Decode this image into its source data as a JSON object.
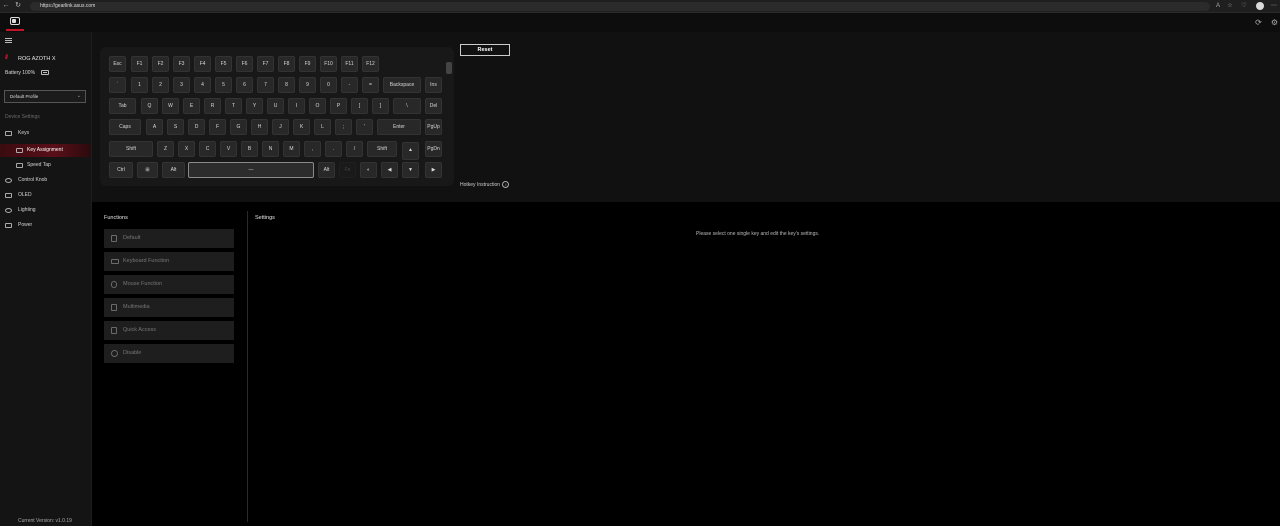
{
  "browser": {
    "url": "https://gearlink.asus.com",
    "back_icon": "back-arrow-icon",
    "refresh_icon": "refresh-icon"
  },
  "sidebar": {
    "device_name": "ROG AZOTH X",
    "battery": "Battery 100%",
    "profile": "Default Profile",
    "section": "Device Settings",
    "items": [
      {
        "label": "Keys"
      },
      {
        "label": "Key Assignment"
      },
      {
        "label": "Speed Tap"
      },
      {
        "label": "Control Knob"
      },
      {
        "label": "OLED"
      },
      {
        "label": "Lighting"
      },
      {
        "label": "Power"
      }
    ],
    "version": "Current Version: v1.0.19"
  },
  "keyboard": {
    "rows": [
      [
        "Esc",
        "F1",
        "F2",
        "F3",
        "F4",
        "F5",
        "F6",
        "F7",
        "F8",
        "F9",
        "F10",
        "F11",
        "F12"
      ],
      [
        "`",
        "1",
        "2",
        "3",
        "4",
        "5",
        "6",
        "7",
        "8",
        "9",
        "0",
        "-",
        "=",
        "Backspace",
        "Ins"
      ],
      [
        "Tab",
        "Q",
        "W",
        "E",
        "R",
        "T",
        "Y",
        "U",
        "I",
        "O",
        "P",
        "[",
        "]",
        "\\",
        "Del"
      ],
      [
        "Caps",
        "A",
        "S",
        "D",
        "F",
        "G",
        "H",
        "J",
        "K",
        "L",
        ";",
        "'",
        "Enter",
        "PgUp"
      ],
      [
        "Shift",
        "Z",
        "X",
        "C",
        "V",
        "B",
        "N",
        "M",
        ",",
        ".",
        "/",
        "Shift",
        "▲",
        "PgDn"
      ],
      [
        "Ctrl",
        "⊞",
        "Alt",
        "—",
        "Alt",
        "Fn",
        "◐",
        "◀",
        "▼",
        "▶"
      ]
    ],
    "reset_label": "Reset",
    "hotkey_label": "Hotkey Instruction",
    "hotkey_icon": "i"
  },
  "functions": {
    "title": "Functions",
    "items": [
      {
        "label": "Default"
      },
      {
        "label": "Keyboard Function"
      },
      {
        "label": "Mouse Function"
      },
      {
        "label": "Multimedia"
      },
      {
        "label": "Quick Access"
      },
      {
        "label": "Disable"
      }
    ]
  },
  "settings": {
    "title": "Settings",
    "message": "Please select one single key and edit the key's settings."
  },
  "colors": {
    "accent": "#c0152a",
    "background": "#000000",
    "sidebar": "#141414"
  }
}
